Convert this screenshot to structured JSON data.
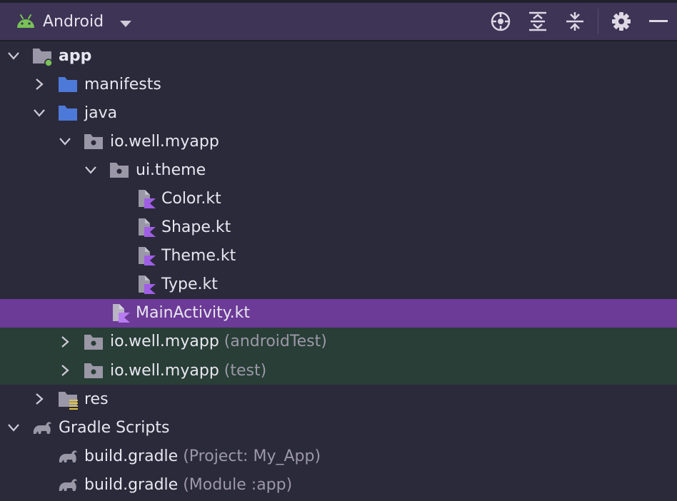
{
  "toolbar": {
    "view_label": "Android",
    "icons": [
      "locate-icon",
      "expand-all-icon",
      "collapse-all-icon",
      "gear-icon",
      "minimize-icon"
    ]
  },
  "tree": [
    {
      "label": "app",
      "hint": "",
      "icon": "module-icon",
      "expanded": true
    },
    {
      "label": "manifests",
      "hint": "",
      "icon": "folder-icon",
      "expanded": false
    },
    {
      "label": "java",
      "hint": "",
      "icon": "folder-icon",
      "expanded": true
    },
    {
      "label": "io.well.myapp",
      "hint": "",
      "icon": "package-icon",
      "expanded": true
    },
    {
      "label": "ui.theme",
      "hint": "",
      "icon": "package-icon",
      "expanded": true
    },
    {
      "label": "Color.kt",
      "hint": "",
      "icon": "kotlin-file-icon"
    },
    {
      "label": "Shape.kt",
      "hint": "",
      "icon": "kotlin-file-icon"
    },
    {
      "label": "Theme.kt",
      "hint": "",
      "icon": "kotlin-file-icon"
    },
    {
      "label": "Type.kt",
      "hint": "",
      "icon": "kotlin-file-icon"
    },
    {
      "label": "MainActivity.kt",
      "hint": "",
      "icon": "kotlin-file-icon",
      "selected": true
    },
    {
      "label": "io.well.myapp",
      "hint": "(androidTest)",
      "icon": "package-icon",
      "expanded": false
    },
    {
      "label": "io.well.myapp",
      "hint": "(test)",
      "icon": "package-icon",
      "expanded": false
    },
    {
      "label": "res",
      "hint": "",
      "icon": "res-folder-icon",
      "expanded": false
    },
    {
      "label": "Gradle Scripts",
      "hint": "",
      "icon": "gradle-icon",
      "expanded": true
    },
    {
      "label": "build.gradle",
      "hint": "(Project: My_App)",
      "icon": "gradle-icon"
    },
    {
      "label": "build.gradle",
      "hint": "(Module :app)",
      "icon": "gradle-icon"
    }
  ],
  "colors": {
    "background": "#2b2a3a",
    "toolbar": "#3d3456",
    "selection": "#6c3a97",
    "test_scope": "#283e36",
    "folder_blue": "#4d79d8",
    "kotlin_purple": "#a05ee6",
    "android_green": "#78c257"
  }
}
